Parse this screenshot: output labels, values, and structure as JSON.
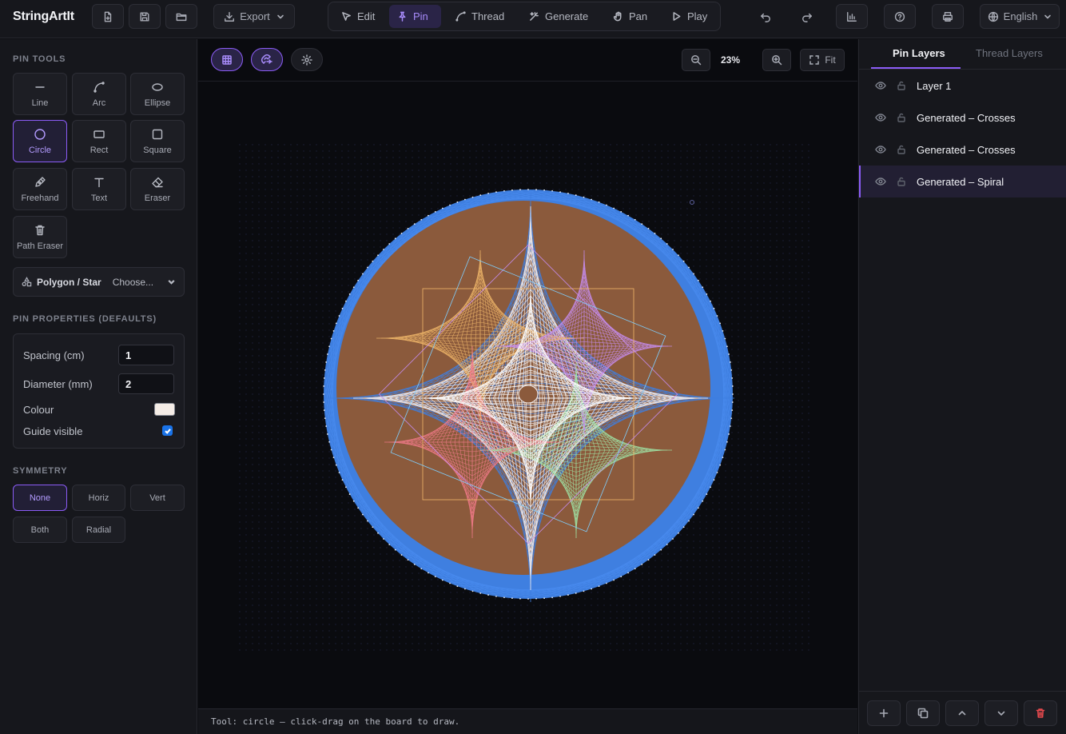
{
  "app": {
    "title": "StringArtIt"
  },
  "toolbar": {
    "export_label": "Export",
    "modes": [
      "Edit",
      "Pin",
      "Thread",
      "Generate",
      "Pan",
      "Play"
    ],
    "active_mode": "Pin",
    "language": "English"
  },
  "pin_tools": {
    "title": "PIN TOOLS",
    "tools": [
      "Line",
      "Arc",
      "Ellipse",
      "Circle",
      "Rect",
      "Square",
      "Freehand",
      "Text",
      "Eraser",
      "Path Eraser"
    ],
    "active_tool": "Circle",
    "polygon_label": "Polygon / Star",
    "polygon_value": "Choose..."
  },
  "pin_properties": {
    "title": "PIN PROPERTIES (DEFAULTS)",
    "spacing_label": "Spacing (cm)",
    "spacing_value": "1",
    "diameter_label": "Diameter (mm)",
    "diameter_value": "2",
    "colour_label": "Colour",
    "colour_value": "#f4ece6",
    "guide_label": "Guide visible",
    "guide_checked": true
  },
  "symmetry": {
    "title": "SYMMETRY",
    "options": [
      "None",
      "Horiz",
      "Vert",
      "Both",
      "Radial"
    ],
    "active": "None"
  },
  "canvas": {
    "zoom": "23%",
    "fit_label": "Fit",
    "board_colour": "#8b5a3c",
    "ring_colour": "#3f7fe0",
    "status_text": "Tool: circle — click-drag on the board to draw."
  },
  "layers": {
    "tabs": [
      "Pin Layers",
      "Thread Layers"
    ],
    "active_tab": "Pin Layers",
    "items": [
      "Layer 1",
      "Generated – Crosses",
      "Generated – Crosses",
      "Generated – Spiral"
    ],
    "active_item": 3
  }
}
